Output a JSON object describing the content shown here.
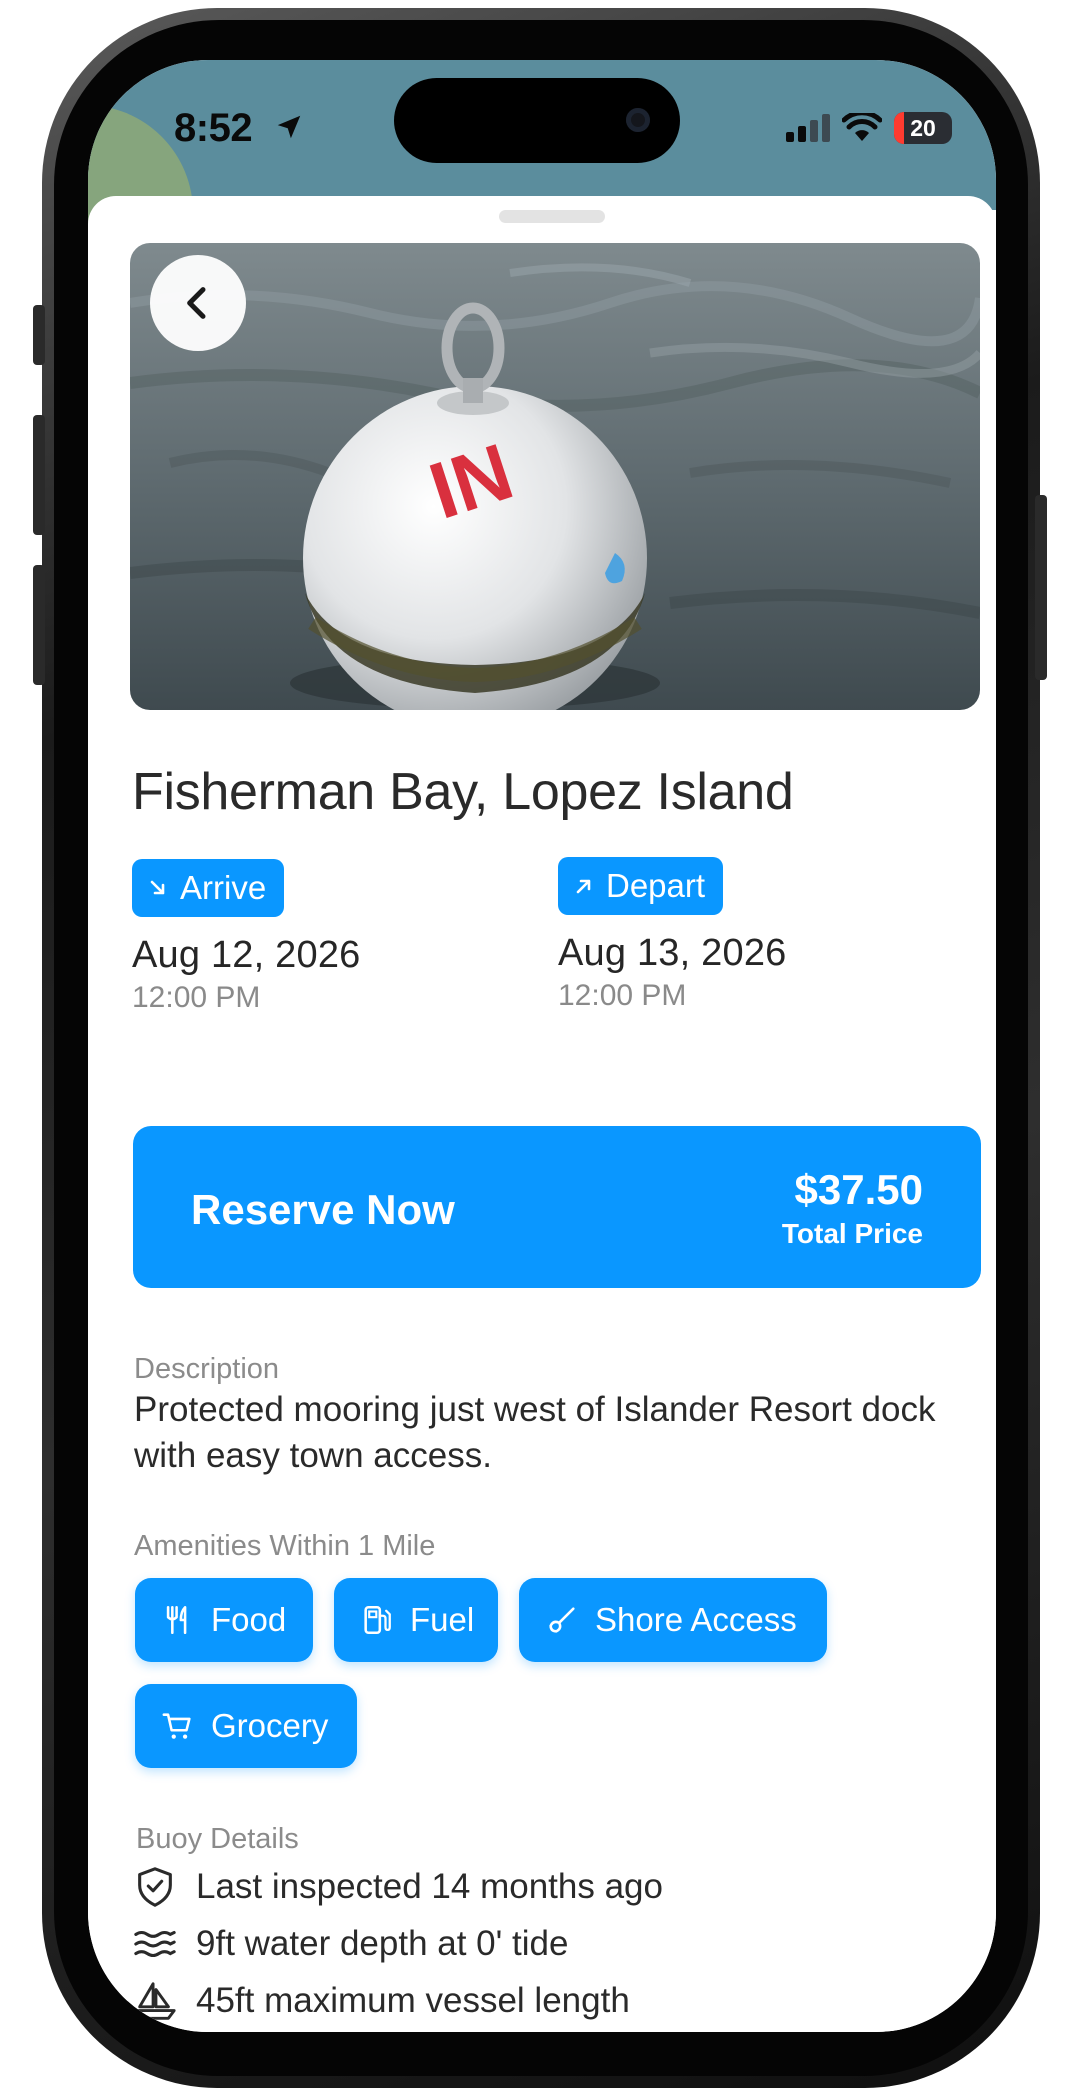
{
  "status_bar": {
    "time": "8:52",
    "battery": "20"
  },
  "icons": {
    "back": "chevron-left-icon",
    "arrive": "arrow-down-right-icon",
    "depart": "arrow-up-right-icon",
    "food": "fork-knife-icon",
    "fuel": "fuel-pump-icon",
    "shore_access": "shore-access-icon",
    "grocery": "cart-icon",
    "inspection": "shield-check-icon",
    "depth": "water-waves-icon",
    "vessel": "sailboat-icon"
  },
  "colors": {
    "accent": "#0a97ff",
    "status_bar_bg": "#5b8d9d"
  },
  "listing": {
    "title": "Fisherman Bay, Lopez Island",
    "arrive": {
      "label": "Arrive",
      "date": "Aug 12, 2026",
      "time": "12:00 PM"
    },
    "depart": {
      "label": "Depart",
      "date": "Aug 13, 2026",
      "time": "12:00 PM"
    }
  },
  "reserve": {
    "label": "Reserve Now",
    "price": "$37.50",
    "price_label": "Total Price"
  },
  "description": {
    "heading": "Description",
    "text": "Protected mooring just west of Islander Resort dock with easy town access."
  },
  "amenities": {
    "heading": "Amenities Within 1 Mile",
    "items": [
      {
        "label": "Food"
      },
      {
        "label": "Fuel"
      },
      {
        "label": "Shore Access"
      },
      {
        "label": "Grocery"
      }
    ]
  },
  "buoy_details": {
    "heading": "Buoy Details",
    "items": [
      {
        "text": "Last inspected 14 months ago"
      },
      {
        "text": "9ft water depth at 0' tide"
      },
      {
        "text": "45ft maximum vessel length"
      }
    ]
  }
}
